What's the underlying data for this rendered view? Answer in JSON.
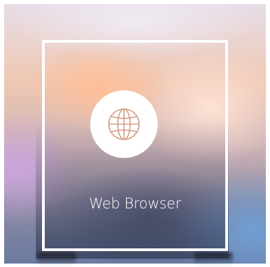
{
  "app": {
    "name": "Web Browser",
    "icon": "globe-icon"
  },
  "colors": {
    "tile_border": "#ffffff",
    "icon_background": "#ffffff",
    "icon_stroke": "#d59a82",
    "label_text": "#ffffff"
  }
}
